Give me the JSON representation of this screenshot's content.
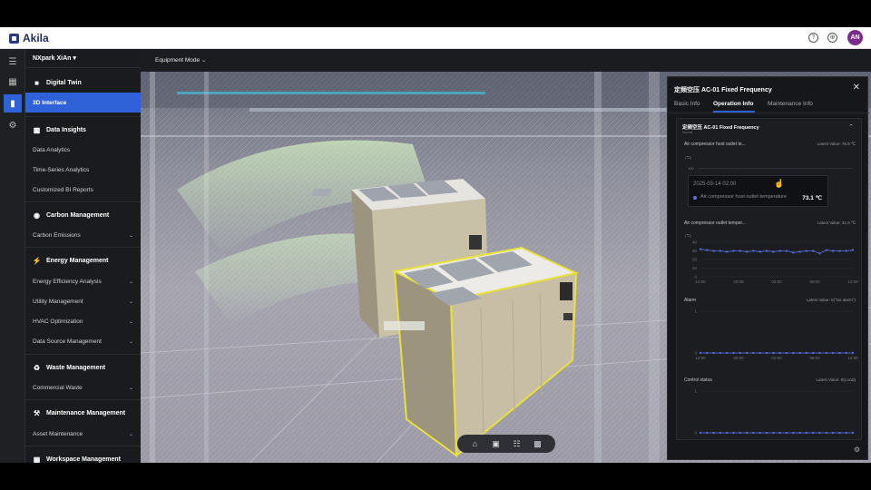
{
  "app": {
    "name": "Akila"
  },
  "topbar": {
    "avatar_initials": "AN",
    "help_icon": "help-circle-icon",
    "globe_icon": "globe-icon"
  },
  "rail": {
    "icons": [
      "menu-icon",
      "building-icon",
      "document-icon",
      "settings-icon"
    ]
  },
  "sidebar": {
    "site": "NXpark XiAn",
    "digital_twin": "Digital Twin",
    "interface_3d": "3D Interface",
    "data_insights": "Data Insights",
    "data_analytics": "Data Analytics",
    "time_series": "Time-Series Analytics",
    "custom_bi": "Customized BI Reports",
    "carbon_mgmt": "Carbon Management",
    "carbon_emissions": "Carbon Emissions",
    "energy_mgmt": "Energy Management",
    "energy_eff": "Energy Efficiency Analysis",
    "utility_mgmt": "Utility Management",
    "hvac": "HVAC Optimization",
    "data_source": "Data Source Management",
    "waste_mgmt": "Waste Management",
    "commercial_waste": "Commercial Waste",
    "maintenance_mgmt": "Maintenance Management",
    "asset_maint": "Asset Maintenance",
    "workspace_mgmt": "Workspace Management"
  },
  "mode": {
    "label": "Equipment Mode"
  },
  "panel": {
    "title": "定频空压 AC-01 Fixed Frequency",
    "tabs": [
      "Basic Info",
      "Operation Info",
      "Maintenance Info"
    ],
    "active_tab": "Operation Info",
    "section_title": "定频空压 AC-01 Fixed Frequency",
    "section_sub": "Normal",
    "metrics": [
      {
        "name": "Air compressor host outlet te...",
        "latest": "Latest Value: 78.9 ℃",
        "unit": "(℃)"
      },
      {
        "name": "Air compressor outlet temper...",
        "latest": "Latest Value: 31.6 ℃",
        "unit": "(℃)"
      },
      {
        "name": "Alarm",
        "latest": "Latest Value: 0(\"No alarm\")",
        "unit": ""
      },
      {
        "name": "Control status",
        "latest": "Latest Value: 0(Local)",
        "unit": ""
      }
    ],
    "tooltip": {
      "time": "2025-03-14 02:00",
      "label": "Air compressor host outlet temperature",
      "value": "73.1 ℃"
    },
    "chart1_ytop": "100",
    "chart2_yticks": [
      "40",
      "30",
      "20",
      "10",
      "0"
    ],
    "chart2_xticks": [
      "14:00",
      "20:00",
      "02:00",
      "08:00",
      "14:00"
    ],
    "chart3_yticks": [
      "1",
      "0"
    ],
    "chart3_xticks": [
      "14:00",
      "20:00",
      "02:00",
      "08:00",
      "14:00"
    ],
    "chart4_yticks": [
      "1",
      "0"
    ]
  },
  "chart_data": [
    {
      "type": "line",
      "title": "Air compressor outlet temper...",
      "ylabel": "(℃)",
      "ylim": [
        0,
        40
      ],
      "x": [
        "14:00",
        "20:00",
        "02:00",
        "08:00",
        "14:00"
      ],
      "series": [
        {
          "values": [
            32,
            31,
            30,
            30,
            29,
            30,
            30,
            29,
            30,
            29,
            30,
            29,
            30,
            30,
            28,
            29,
            30,
            30,
            27,
            31,
            30,
            30,
            30,
            31
          ]
        }
      ]
    },
    {
      "type": "line",
      "title": "Alarm",
      "ylim": [
        0,
        1
      ],
      "x": [
        "14:00",
        "20:00",
        "02:00",
        "08:00",
        "14:00"
      ],
      "series": [
        {
          "values": [
            0,
            0,
            0,
            0,
            0,
            0,
            0,
            0,
            0,
            0,
            0,
            0,
            0,
            0,
            0,
            0,
            0,
            0,
            0,
            0,
            0,
            0,
            0,
            0
          ]
        }
      ]
    },
    {
      "type": "line",
      "title": "Control status",
      "ylim": [
        0,
        1
      ],
      "series": [
        {
          "values": [
            0,
            0,
            0,
            0,
            0,
            0,
            0,
            0,
            0,
            0,
            0,
            0,
            0,
            0,
            0,
            0,
            0,
            0,
            0,
            0,
            0,
            0,
            0,
            0
          ]
        }
      ]
    }
  ],
  "toolbar": {
    "icons": [
      "home-icon",
      "focus-icon",
      "hierarchy-icon",
      "grid-icon"
    ]
  }
}
